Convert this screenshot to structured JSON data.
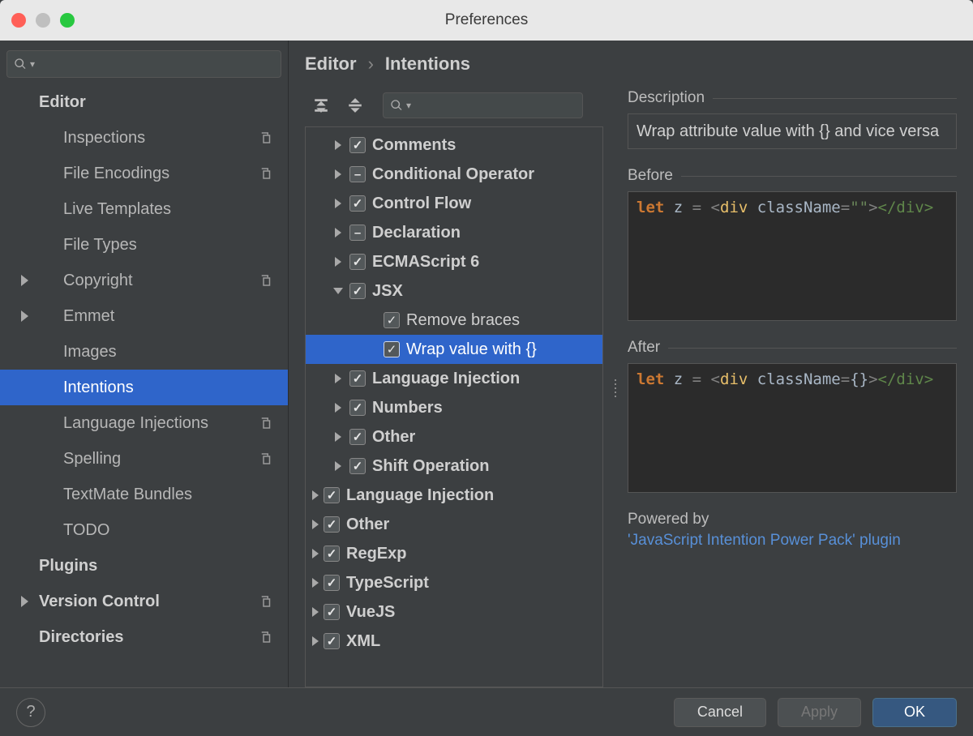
{
  "window": {
    "title": "Preferences"
  },
  "sidebar": {
    "items": [
      {
        "label": "Editor",
        "kind": "group",
        "expanded": false,
        "copy": false
      },
      {
        "label": "Inspections",
        "kind": "sub",
        "copy": true
      },
      {
        "label": "File Encodings",
        "kind": "sub",
        "copy": true
      },
      {
        "label": "Live Templates",
        "kind": "sub",
        "copy": false
      },
      {
        "label": "File Types",
        "kind": "sub",
        "copy": false
      },
      {
        "label": "Copyright",
        "kind": "sub",
        "arrow": true,
        "copy": true
      },
      {
        "label": "Emmet",
        "kind": "sub",
        "arrow": true,
        "copy": false
      },
      {
        "label": "Images",
        "kind": "sub",
        "copy": false
      },
      {
        "label": "Intentions",
        "kind": "sub",
        "copy": false,
        "selected": true
      },
      {
        "label": "Language Injections",
        "kind": "sub",
        "copy": true
      },
      {
        "label": "Spelling",
        "kind": "sub",
        "copy": true
      },
      {
        "label": "TextMate Bundles",
        "kind": "sub",
        "copy": false
      },
      {
        "label": "TODO",
        "kind": "sub",
        "copy": false
      },
      {
        "label": "Plugins",
        "kind": "group",
        "copy": false
      },
      {
        "label": "Version Control",
        "kind": "group",
        "arrow": true,
        "copy": true
      },
      {
        "label": "Directories",
        "kind": "group",
        "copy": true
      }
    ]
  },
  "breadcrumb": {
    "root": "Editor",
    "leaf": "Intentions"
  },
  "tree": {
    "nodes": [
      {
        "label": "Comments",
        "state": "checked",
        "depth": 1,
        "arrow": "right"
      },
      {
        "label": "Conditional Operator",
        "state": "mixed",
        "depth": 1,
        "arrow": "right"
      },
      {
        "label": "Control Flow",
        "state": "checked",
        "depth": 1,
        "arrow": "right"
      },
      {
        "label": "Declaration",
        "state": "mixed",
        "depth": 1,
        "arrow": "right"
      },
      {
        "label": "ECMAScript 6",
        "state": "checked",
        "depth": 1,
        "arrow": "right"
      },
      {
        "label": "JSX",
        "state": "checked",
        "depth": 1,
        "arrow": "down"
      },
      {
        "label": "Remove braces",
        "state": "checked",
        "depth": 2,
        "arrow": "none"
      },
      {
        "label": "Wrap value with {}",
        "state": "checked",
        "depth": 2,
        "arrow": "none",
        "selected": true
      },
      {
        "label": "Language Injection",
        "state": "checked",
        "depth": 1,
        "arrow": "right"
      },
      {
        "label": "Numbers",
        "state": "checked",
        "depth": 1,
        "arrow": "right"
      },
      {
        "label": "Other",
        "state": "checked",
        "depth": 1,
        "arrow": "right"
      },
      {
        "label": "Shift Operation",
        "state": "checked",
        "depth": 1,
        "arrow": "right"
      },
      {
        "label": "Language Injection",
        "state": "checked",
        "depth": 0,
        "arrow": "right"
      },
      {
        "label": "Other",
        "state": "checked",
        "depth": 0,
        "arrow": "right"
      },
      {
        "label": "RegExp",
        "state": "checked",
        "depth": 0,
        "arrow": "right"
      },
      {
        "label": "TypeScript",
        "state": "checked",
        "depth": 0,
        "arrow": "right"
      },
      {
        "label": "VueJS",
        "state": "checked",
        "depth": 0,
        "arrow": "right"
      },
      {
        "label": "XML",
        "state": "checked",
        "depth": 0,
        "arrow": "right"
      }
    ]
  },
  "detail": {
    "desc_label": "Description",
    "desc_text": "Wrap attribute value with {} and vice versa",
    "before_label": "Before",
    "after_label": "After",
    "powered_label": "Powered by",
    "plugin_link": "'JavaScript Intention Power Pack' plugin",
    "code_before": {
      "kw": "let",
      "var": " z ",
      "eq": "= ",
      "o1": "<",
      "tag": "div",
      "sp": " ",
      "attr": "className",
      "eq2": "=",
      "q": "\"\"",
      "o2": ">",
      "ctag": "</div>"
    },
    "code_after": {
      "kw": "let",
      "var": " z ",
      "eq": "= ",
      "o1": "<",
      "tag": "div",
      "sp": " ",
      "attr": "className",
      "eq2": "=",
      "q": "{}",
      "o2": ">",
      "ctag": "</div>"
    }
  },
  "buttons": {
    "cancel": "Cancel",
    "apply": "Apply",
    "ok": "OK"
  }
}
